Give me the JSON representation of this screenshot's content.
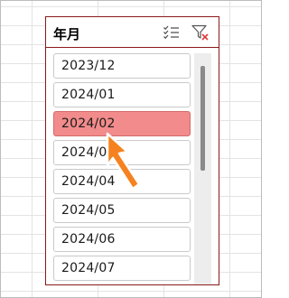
{
  "slicer": {
    "title": "年月",
    "items": [
      {
        "label": "2023/12",
        "selected": false
      },
      {
        "label": "2024/01",
        "selected": false
      },
      {
        "label": "2024/02",
        "selected": true
      },
      {
        "label": "2024/0",
        "selected": false
      },
      {
        "label": "2024/04",
        "selected": false
      },
      {
        "label": "2024/05",
        "selected": false
      },
      {
        "label": "2024/06",
        "selected": false
      },
      {
        "label": "2024/07",
        "selected": false
      }
    ],
    "icons": {
      "multiselect": "multi-select-icon",
      "clear_filter": "clear-filter-icon"
    }
  },
  "annotation": {
    "icon": "pointing-arrow-icon",
    "color": "#f5821f"
  },
  "colors": {
    "slicer_border": "#8b1a1a",
    "selected_fill": "#f28b8b",
    "clear_filter_x": "#e03c3c"
  }
}
